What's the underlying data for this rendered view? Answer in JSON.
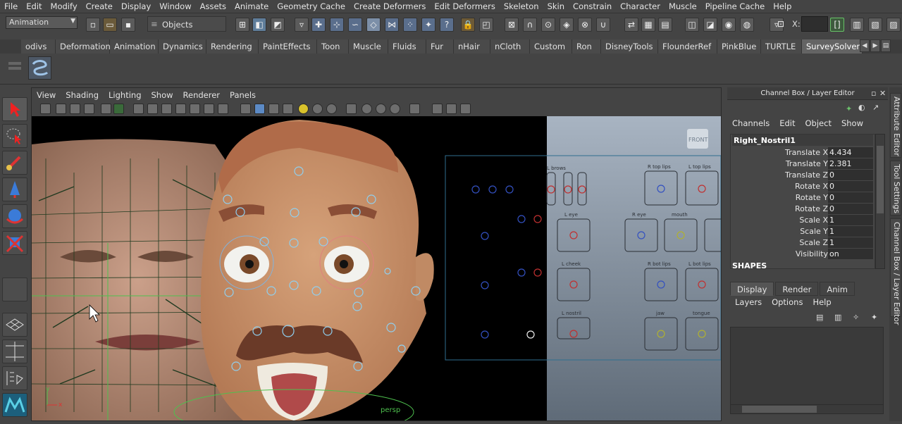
{
  "menubar": {
    "items": [
      "File",
      "Edit",
      "Modify",
      "Create",
      "Display",
      "Window",
      "Assets",
      "Animate",
      "Geometry Cache",
      "Create Deformers",
      "Edit Deformers",
      "Skeleton",
      "Skin",
      "Constrain",
      "Character",
      "Muscle",
      "Pipeline Cache",
      "Help"
    ]
  },
  "statusline": {
    "mode": "Animation",
    "selection_field": "Objects",
    "x_label": "X:"
  },
  "shelf": {
    "tabs": [
      "odivs",
      "Deformation",
      "Animation",
      "Dynamics",
      "Rendering",
      "PaintEffects",
      "Toon",
      "Muscle",
      "Fluids",
      "Fur",
      "nHair",
      "nCloth",
      "Custom",
      "Ron",
      "DisneyTools",
      "FlounderRef",
      "PinkBlue",
      "TURTLE",
      "SurveySolver"
    ],
    "active_tab": "SurveySolver"
  },
  "viewport": {
    "menu": [
      "View",
      "Shading",
      "Lighting",
      "Show",
      "Renderer",
      "Panels"
    ],
    "camera_label": "persp",
    "front_label": "FRONT",
    "face_rig_panels": {
      "brows": "L brows",
      "r_top_lips": "R top lips",
      "l_top_lips": "L top lips",
      "l_eye": "L eye",
      "r_eye": "R eye",
      "mouth": "mouth",
      "l_cheek": "L cheek",
      "r_bot_lips": "R bot lips",
      "l_bot_lips": "L bot lips",
      "l_nostril": "L nostril",
      "jaw": "jaw",
      "tongue": "tongue"
    }
  },
  "channelbox": {
    "title": "Channel Box / Layer Editor",
    "menu": [
      "Channels",
      "Edit",
      "Object",
      "Show"
    ],
    "object_name": "Right_Nostril1",
    "attributes": [
      {
        "label": "Translate X",
        "value": "4.434"
      },
      {
        "label": "Translate Y",
        "value": "2.381"
      },
      {
        "label": "Translate Z",
        "value": "0"
      },
      {
        "label": "Rotate X",
        "value": "0"
      },
      {
        "label": "Rotate Y",
        "value": "0"
      },
      {
        "label": "Rotate Z",
        "value": "0"
      },
      {
        "label": "Scale X",
        "value": "1"
      },
      {
        "label": "Scale Y",
        "value": "1"
      },
      {
        "label": "Scale Z",
        "value": "1"
      },
      {
        "label": "Visibility",
        "value": "on"
      }
    ],
    "shapes_label": "SHAPES",
    "layer_tabs": [
      "Display",
      "Render",
      "Anim"
    ],
    "active_layer_tab": "Display",
    "layer_menu": [
      "Layers",
      "Options",
      "Help"
    ]
  },
  "side_tabs": [
    "Attribute Editor",
    "Tool Settings",
    "Channel Box / Layer Editor"
  ],
  "colors": {
    "ui_bg": "#444444",
    "viewport_bg": "#000000",
    "gradient_top": "#a8b4c2",
    "gradient_bottom": "#5f6b78",
    "active_tab": "#646464"
  }
}
